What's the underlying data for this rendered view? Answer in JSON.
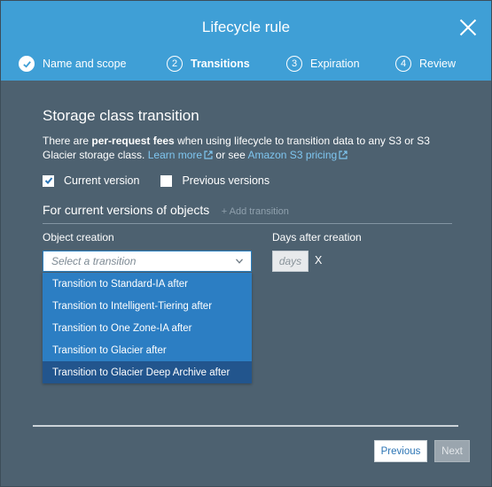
{
  "dialog": {
    "title": "Lifecycle rule"
  },
  "steps": [
    {
      "number": "",
      "label": "Name and scope",
      "state": "done"
    },
    {
      "number": "2",
      "label": "Transitions",
      "state": "active"
    },
    {
      "number": "3",
      "label": "Expiration",
      "state": "pending"
    },
    {
      "number": "4",
      "label": "Review",
      "state": "pending"
    }
  ],
  "storage": {
    "section_title": "Storage class transition",
    "desc_prefix": "There are ",
    "desc_bold": "per-request fees",
    "desc_middle": " when using lifecycle to transition data to any S3 or S3 Glacier storage class. ",
    "learn_more": "Learn more",
    "or_see": " or see ",
    "pricing_link": "Amazon S3 pricing",
    "current_version_label": "Current version",
    "current_version_checked": true,
    "previous_versions_label": "Previous versions",
    "previous_versions_checked": false
  },
  "transition": {
    "subsection_title": "For current versions of objects",
    "add_transition": "+ Add transition",
    "object_creation_label": "Object creation",
    "days_label": "Days after creation",
    "select_placeholder": "Select a transition",
    "days_placeholder": "days",
    "remove_label": "X",
    "options": [
      "Transition to Standard-IA after",
      "Transition to Intelligent-Tiering after",
      "Transition to One Zone-IA after",
      "Transition to Glacier after",
      "Transition to Glacier Deep Archive after"
    ],
    "highlighted_option": "Transition to Glacier Deep Archive after"
  },
  "footer": {
    "previous_label": "Previous",
    "next_label": "Next"
  },
  "colors": {
    "header": "#3f9fd6",
    "body": "#4d6170",
    "dropdown": "#2c7ec3",
    "dropdown_selected": "#22558d",
    "link": "#7fc6f0"
  }
}
